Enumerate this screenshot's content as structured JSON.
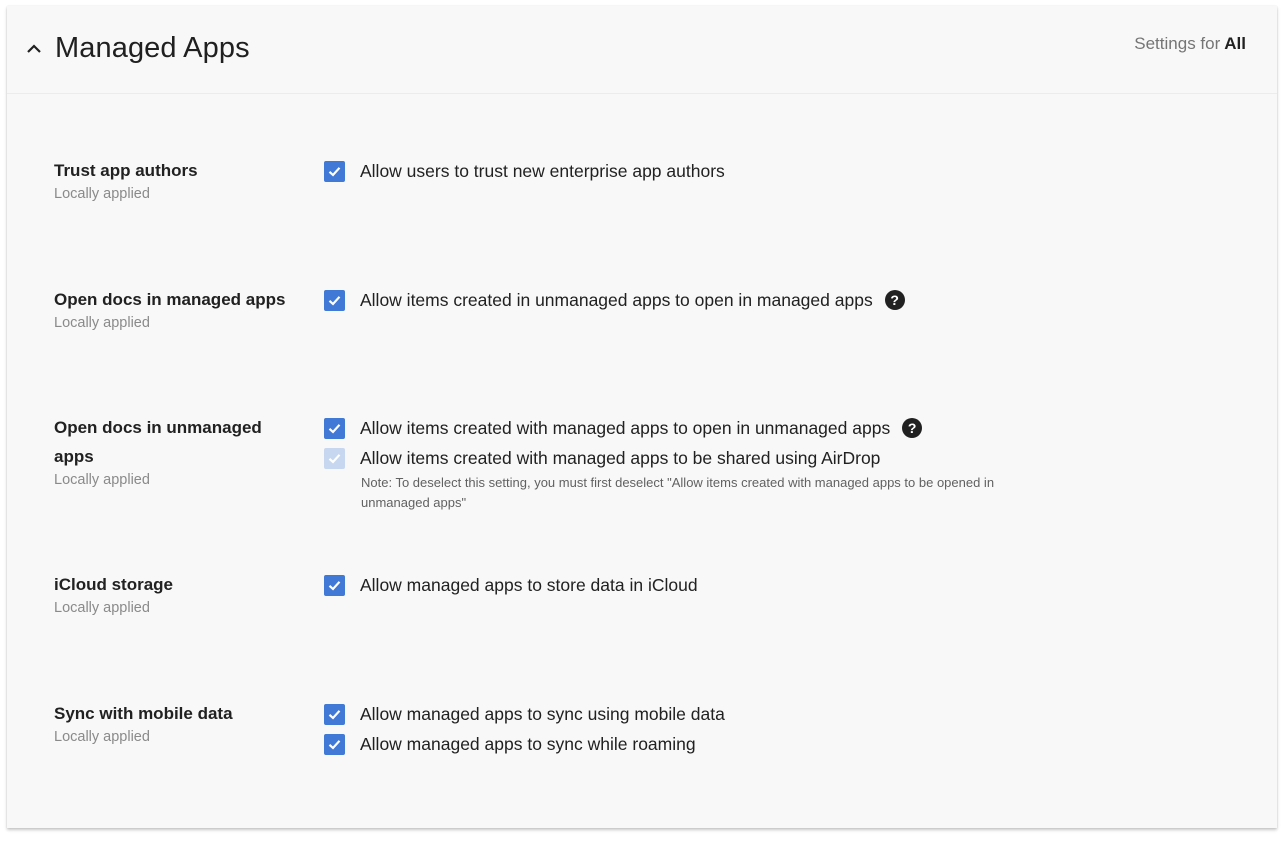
{
  "header": {
    "title": "Managed Apps",
    "settings_for_label": "Settings for",
    "settings_for_value": "All"
  },
  "settings": [
    {
      "title": "Trust app authors",
      "subtitle": "Locally applied",
      "options": [
        {
          "label": "Allow users to trust new enterprise app authors",
          "checked": true
        }
      ]
    },
    {
      "title": "Open docs in managed apps",
      "subtitle": "Locally applied",
      "options": [
        {
          "label": "Allow items created in unmanaged apps to open in managed apps",
          "checked": true,
          "help": "?"
        }
      ]
    },
    {
      "title": "Open docs in unmanaged apps",
      "subtitle": "Locally applied",
      "options": [
        {
          "label": "Allow items created with managed apps to open in unmanaged apps",
          "checked": true,
          "help": "?"
        },
        {
          "label": "Allow items created with managed apps to be shared using AirDrop",
          "checked": true,
          "disabled": true
        }
      ],
      "note": "Note: To deselect this setting, you must first deselect \"Allow items created with managed apps to be opened in unmanaged apps\""
    },
    {
      "title": "iCloud storage",
      "subtitle": "Locally applied",
      "options": [
        {
          "label": "Allow managed apps to store data in iCloud",
          "checked": true
        }
      ]
    },
    {
      "title": "Sync with mobile data",
      "subtitle": "Locally applied",
      "options": [
        {
          "label": "Allow managed apps to sync using mobile data",
          "checked": true
        },
        {
          "label": "Allow managed apps to sync while roaming",
          "checked": true
        }
      ]
    }
  ],
  "colors": {
    "checkbox": "#4179d6",
    "checkbox_disabled": "#c8d7f0",
    "card_background": "#f8f8f8"
  }
}
